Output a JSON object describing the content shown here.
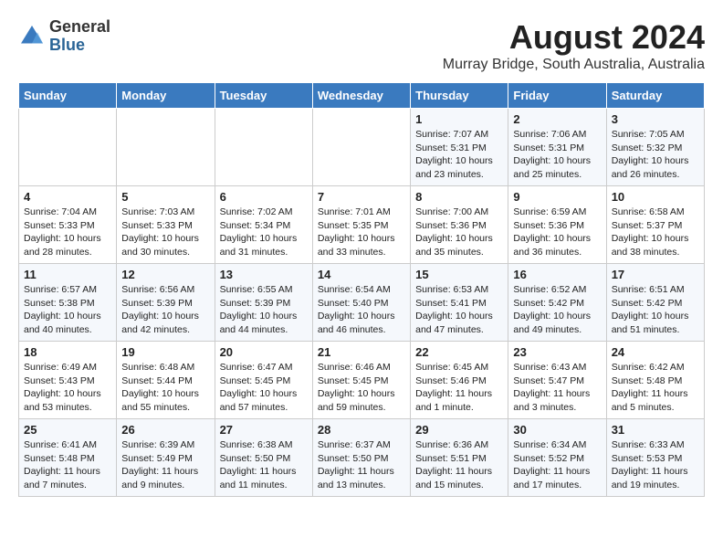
{
  "header": {
    "logo_general": "General",
    "logo_blue": "Blue",
    "month_year": "August 2024",
    "location": "Murray Bridge, South Australia, Australia"
  },
  "days_of_week": [
    "Sunday",
    "Monday",
    "Tuesday",
    "Wednesday",
    "Thursday",
    "Friday",
    "Saturday"
  ],
  "weeks": [
    [
      {
        "day": "",
        "detail": ""
      },
      {
        "day": "",
        "detail": ""
      },
      {
        "day": "",
        "detail": ""
      },
      {
        "day": "",
        "detail": ""
      },
      {
        "day": "1",
        "detail": "Sunrise: 7:07 AM\nSunset: 5:31 PM\nDaylight: 10 hours\nand 23 minutes."
      },
      {
        "day": "2",
        "detail": "Sunrise: 7:06 AM\nSunset: 5:31 PM\nDaylight: 10 hours\nand 25 minutes."
      },
      {
        "day": "3",
        "detail": "Sunrise: 7:05 AM\nSunset: 5:32 PM\nDaylight: 10 hours\nand 26 minutes."
      }
    ],
    [
      {
        "day": "4",
        "detail": "Sunrise: 7:04 AM\nSunset: 5:33 PM\nDaylight: 10 hours\nand 28 minutes."
      },
      {
        "day": "5",
        "detail": "Sunrise: 7:03 AM\nSunset: 5:33 PM\nDaylight: 10 hours\nand 30 minutes."
      },
      {
        "day": "6",
        "detail": "Sunrise: 7:02 AM\nSunset: 5:34 PM\nDaylight: 10 hours\nand 31 minutes."
      },
      {
        "day": "7",
        "detail": "Sunrise: 7:01 AM\nSunset: 5:35 PM\nDaylight: 10 hours\nand 33 minutes."
      },
      {
        "day": "8",
        "detail": "Sunrise: 7:00 AM\nSunset: 5:36 PM\nDaylight: 10 hours\nand 35 minutes."
      },
      {
        "day": "9",
        "detail": "Sunrise: 6:59 AM\nSunset: 5:36 PM\nDaylight: 10 hours\nand 36 minutes."
      },
      {
        "day": "10",
        "detail": "Sunrise: 6:58 AM\nSunset: 5:37 PM\nDaylight: 10 hours\nand 38 minutes."
      }
    ],
    [
      {
        "day": "11",
        "detail": "Sunrise: 6:57 AM\nSunset: 5:38 PM\nDaylight: 10 hours\nand 40 minutes."
      },
      {
        "day": "12",
        "detail": "Sunrise: 6:56 AM\nSunset: 5:39 PM\nDaylight: 10 hours\nand 42 minutes."
      },
      {
        "day": "13",
        "detail": "Sunrise: 6:55 AM\nSunset: 5:39 PM\nDaylight: 10 hours\nand 44 minutes."
      },
      {
        "day": "14",
        "detail": "Sunrise: 6:54 AM\nSunset: 5:40 PM\nDaylight: 10 hours\nand 46 minutes."
      },
      {
        "day": "15",
        "detail": "Sunrise: 6:53 AM\nSunset: 5:41 PM\nDaylight: 10 hours\nand 47 minutes."
      },
      {
        "day": "16",
        "detail": "Sunrise: 6:52 AM\nSunset: 5:42 PM\nDaylight: 10 hours\nand 49 minutes."
      },
      {
        "day": "17",
        "detail": "Sunrise: 6:51 AM\nSunset: 5:42 PM\nDaylight: 10 hours\nand 51 minutes."
      }
    ],
    [
      {
        "day": "18",
        "detail": "Sunrise: 6:49 AM\nSunset: 5:43 PM\nDaylight: 10 hours\nand 53 minutes."
      },
      {
        "day": "19",
        "detail": "Sunrise: 6:48 AM\nSunset: 5:44 PM\nDaylight: 10 hours\nand 55 minutes."
      },
      {
        "day": "20",
        "detail": "Sunrise: 6:47 AM\nSunset: 5:45 PM\nDaylight: 10 hours\nand 57 minutes."
      },
      {
        "day": "21",
        "detail": "Sunrise: 6:46 AM\nSunset: 5:45 PM\nDaylight: 10 hours\nand 59 minutes."
      },
      {
        "day": "22",
        "detail": "Sunrise: 6:45 AM\nSunset: 5:46 PM\nDaylight: 11 hours\nand 1 minute."
      },
      {
        "day": "23",
        "detail": "Sunrise: 6:43 AM\nSunset: 5:47 PM\nDaylight: 11 hours\nand 3 minutes."
      },
      {
        "day": "24",
        "detail": "Sunrise: 6:42 AM\nSunset: 5:48 PM\nDaylight: 11 hours\nand 5 minutes."
      }
    ],
    [
      {
        "day": "25",
        "detail": "Sunrise: 6:41 AM\nSunset: 5:48 PM\nDaylight: 11 hours\nand 7 minutes."
      },
      {
        "day": "26",
        "detail": "Sunrise: 6:39 AM\nSunset: 5:49 PM\nDaylight: 11 hours\nand 9 minutes."
      },
      {
        "day": "27",
        "detail": "Sunrise: 6:38 AM\nSunset: 5:50 PM\nDaylight: 11 hours\nand 11 minutes."
      },
      {
        "day": "28",
        "detail": "Sunrise: 6:37 AM\nSunset: 5:50 PM\nDaylight: 11 hours\nand 13 minutes."
      },
      {
        "day": "29",
        "detail": "Sunrise: 6:36 AM\nSunset: 5:51 PM\nDaylight: 11 hours\nand 15 minutes."
      },
      {
        "day": "30",
        "detail": "Sunrise: 6:34 AM\nSunset: 5:52 PM\nDaylight: 11 hours\nand 17 minutes."
      },
      {
        "day": "31",
        "detail": "Sunrise: 6:33 AM\nSunset: 5:53 PM\nDaylight: 11 hours\nand 19 minutes."
      }
    ]
  ]
}
